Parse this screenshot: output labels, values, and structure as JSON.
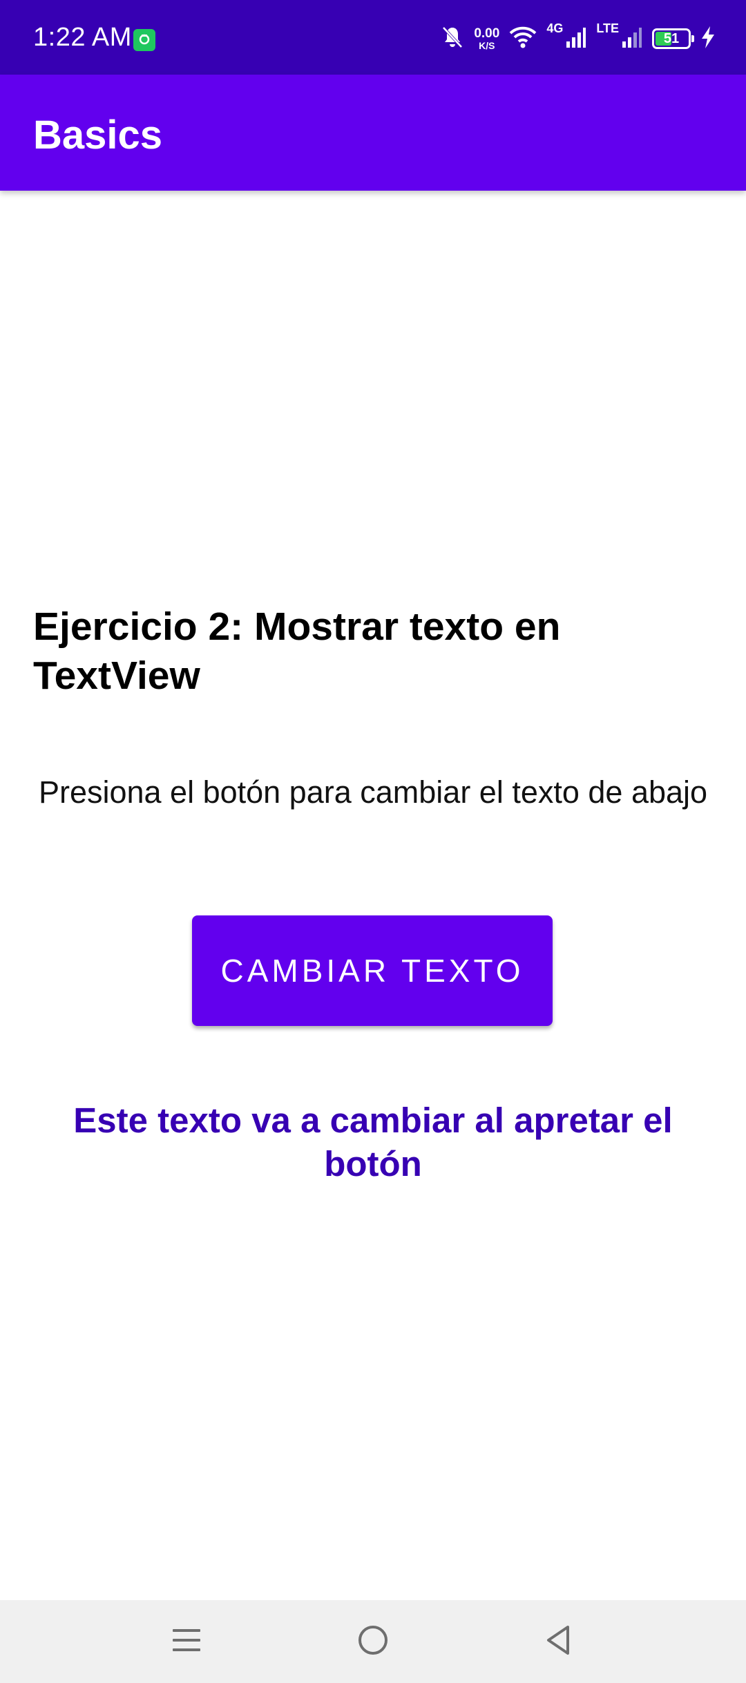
{
  "status_bar": {
    "time": "1:22 AM",
    "net_speed_value": "0.00",
    "net_speed_unit": "K/S",
    "network_label_1": "4G",
    "network_label_2": "LTE",
    "battery_level": "51",
    "battery_fraction": 0.51,
    "icons": [
      "app-notification-icon",
      "mute-bell-icon",
      "wifi-icon",
      "signal-icon",
      "signal-icon",
      "battery-icon",
      "charging-bolt-icon"
    ]
  },
  "app_bar": {
    "title": "Basics"
  },
  "content": {
    "exercise_title": "Ejercicio 2: Mostrar texto en TextView",
    "instruction": "Presiona el botón para cambiar el texto de abajo",
    "button_label": "CAMBIAR TEXTO",
    "result_text": "Este texto va a cambiar al apretar el botón"
  },
  "nav_bar": {
    "icons": [
      "recent-apps-icon",
      "home-icon",
      "back-icon"
    ]
  },
  "colors": {
    "status_bar": "#3700b3",
    "primary": "#6200ee",
    "result_text": "#3700b3",
    "nav_bar": "#f0f0f0"
  }
}
